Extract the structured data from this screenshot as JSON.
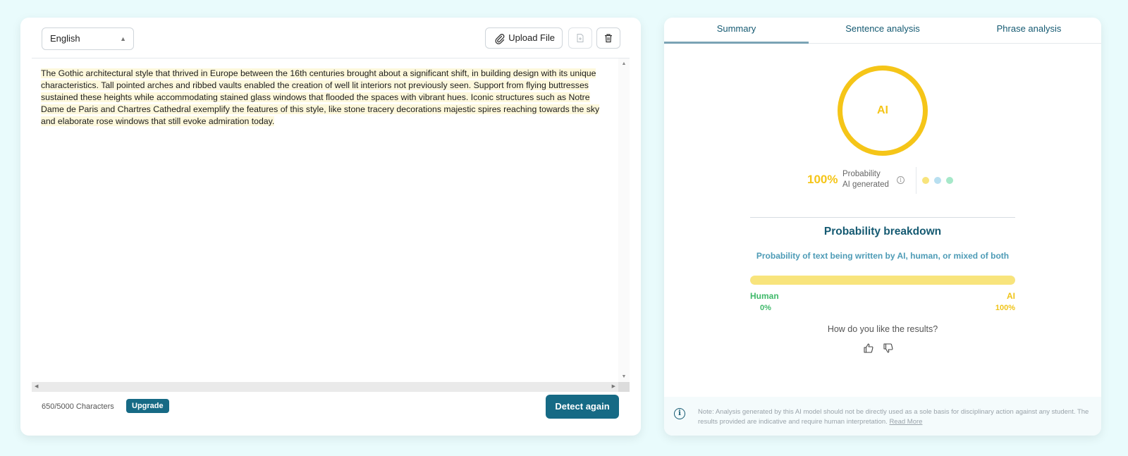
{
  "editor": {
    "language": "English",
    "upload_label": "Upload File",
    "text": "The Gothic architectural style that thrived in Europe between the 16th centuries brought about a significant shift, in building design with its unique characteristics. Tall pointed arches and ribbed vaults enabled the creation of well lit interiors not previously seen. Support from flying buttresses sustained these heights while accommodating stained glass windows that flooded the spaces with vibrant hues. Iconic structures such as Notre Dame de Paris and Chartres Cathedral exemplify the features of this style, like stone tracery decorations majestic spires reaching towards the sky and elaborate rose windows that still evoke admiration today.",
    "char_count": "650/5000 Characters",
    "upgrade_label": "Upgrade",
    "detect_label": "Detect again"
  },
  "tabs": [
    {
      "label": "Summary",
      "active": true
    },
    {
      "label": "Sentence analysis",
      "active": false
    },
    {
      "label": "Phrase analysis",
      "active": false
    }
  ],
  "summary": {
    "ring_label": "AI",
    "percent": "100%",
    "prob_line1": "Probability",
    "prob_line2": "AI generated",
    "dot_colors": [
      "#f8e47c",
      "#b8dff0",
      "#a6e8c9"
    ],
    "ring_color": "#f5c518"
  },
  "breakdown": {
    "title": "Probability breakdown",
    "subtitle": "Probability of text being written by AI, human, or mixed of both",
    "ai_fraction": 1.0,
    "human_label": "Human",
    "human_pct": "0%",
    "ai_label": "AI",
    "ai_pct": "100%",
    "feedback_question": "How do you like the results?"
  },
  "note": {
    "text": "Note: Analysis generated by this AI model should not be directly used as a sole basis for disciplinary action against any student. The results provided are indicative and require human interpretation.",
    "link": "Read More"
  }
}
